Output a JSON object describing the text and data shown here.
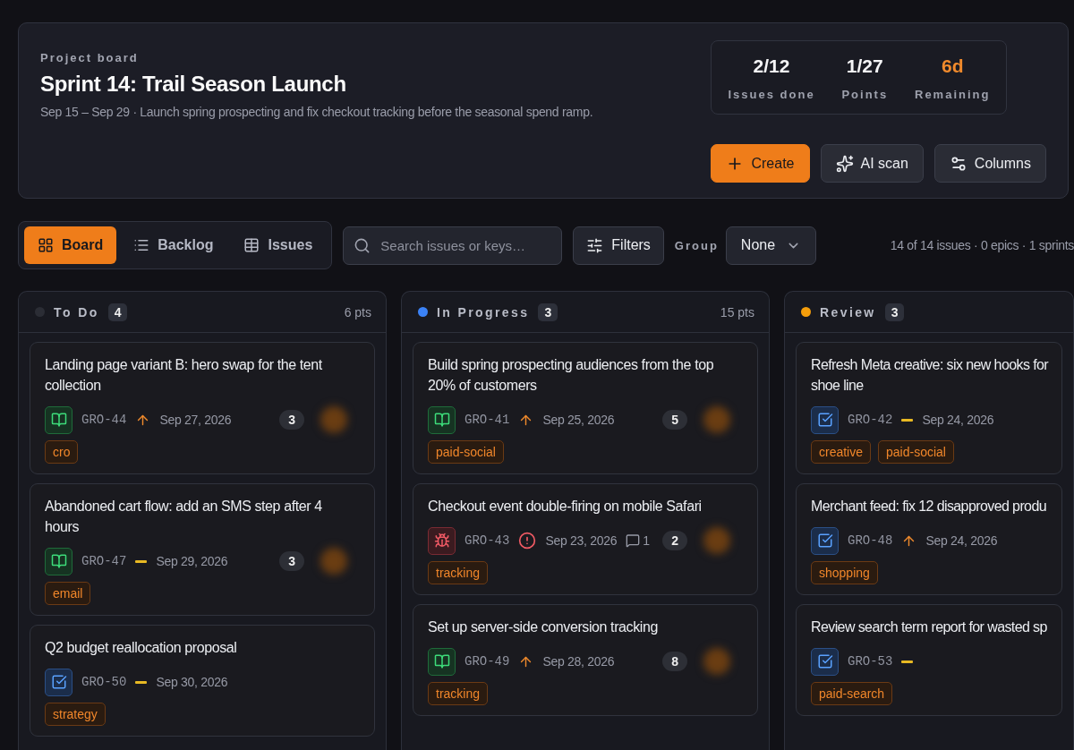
{
  "header": {
    "eyebrow": "Project board",
    "title": "Sprint 14: Trail Season Launch",
    "subtitle": "Sep 15 – Sep 29 · Launch spring prospecting and fix checkout tracking before the seasonal spend ramp.",
    "stats": [
      {
        "value": "2/12",
        "label": "Issues done",
        "kind": "plain"
      },
      {
        "value": "1/27",
        "label": "Points",
        "kind": "plain"
      },
      {
        "value": "6d",
        "label": "Remaining",
        "kind": "accent"
      }
    ],
    "actions": [
      {
        "label": "Create",
        "kind": "primary"
      },
      {
        "label": "AI scan",
        "kind": "secondary"
      },
      {
        "label": "Columns",
        "kind": "secondary"
      }
    ]
  },
  "view_tabs": [
    {
      "label": "Board",
      "selected": true
    },
    {
      "label": "Backlog",
      "selected": false
    },
    {
      "label": "Issues",
      "selected": false
    }
  ],
  "search": {
    "placeholder": "Search issues or keys…"
  },
  "filters_button": "Filters",
  "group": {
    "label": "Group",
    "value": "None"
  },
  "summary": "14 of 14 issues · 0 epics · 1 sprints",
  "columns": [
    {
      "name": "To Do",
      "count": "4",
      "points": "6 pts",
      "color": "#2b2d35",
      "cards": [
        {
          "title": "Landing page variant B: hero swap for the tent collection",
          "kind": "story",
          "key": "GRO-44",
          "priority": {
            "kind": "high"
          },
          "date": "Sep 27, 2026",
          "points": "3",
          "tags": [
            "cro"
          ]
        },
        {
          "title": "Abandoned cart flow: add an SMS step after 4 hours",
          "kind": "story",
          "key": "GRO-47",
          "priority": {
            "kind": "medium"
          },
          "date": "Sep 29, 2026",
          "points": "3",
          "tags": [
            "email"
          ]
        },
        {
          "title": "Q2 budget reallocation proposal",
          "kind": "task",
          "key": "GRO-50",
          "priority": {
            "kind": "medium"
          },
          "date": "Sep 30, 2026",
          "tags": [
            "strategy"
          ]
        }
      ]
    },
    {
      "name": "In Progress",
      "count": "3",
      "points": "15 pts",
      "color": "#3b82f6",
      "cards": [
        {
          "title": "Build spring prospecting audiences from the top 20% of customers",
          "kind": "story",
          "key": "GRO-41",
          "priority": {
            "kind": "high"
          },
          "date": "Sep 25, 2026",
          "points": "5",
          "tags": [
            "paid-social"
          ]
        },
        {
          "title": "Checkout event double-firing on mobile Safari",
          "kind": "bug",
          "key": "GRO-43",
          "priority": {
            "kind": "critical"
          },
          "date": "Sep 23, 2026",
          "comments": "1",
          "points": "2",
          "tags": [
            "tracking"
          ]
        },
        {
          "title": "Set up server-side conversion tracking",
          "kind": "story",
          "key": "GRO-49",
          "priority": {
            "kind": "high"
          },
          "date": "Sep 28, 2026",
          "points": "8",
          "tags": [
            "tracking"
          ]
        }
      ]
    },
    {
      "name": "Review",
      "count": "3",
      "color": "#f59e0b",
      "cards": [
        {
          "title": "Refresh Meta creative: six new hooks for shoe line",
          "kind": "task",
          "key": "GRO-42",
          "priority": {
            "kind": "medium"
          },
          "date": "Sep 24, 2026",
          "tags": [
            "creative",
            "paid-social"
          ]
        },
        {
          "title": "Merchant feed: fix 12 disapproved produ",
          "kind": "task",
          "key": "GRO-48",
          "priority": {
            "kind": "high"
          },
          "date": "Sep 24, 2026",
          "tags": [
            "shopping"
          ]
        },
        {
          "title": "Review search term report for wasted sp",
          "kind": "task",
          "key": "GRO-53",
          "priority": {
            "kind": "medium"
          },
          "tags": [
            "paid-search"
          ]
        }
      ]
    }
  ]
}
